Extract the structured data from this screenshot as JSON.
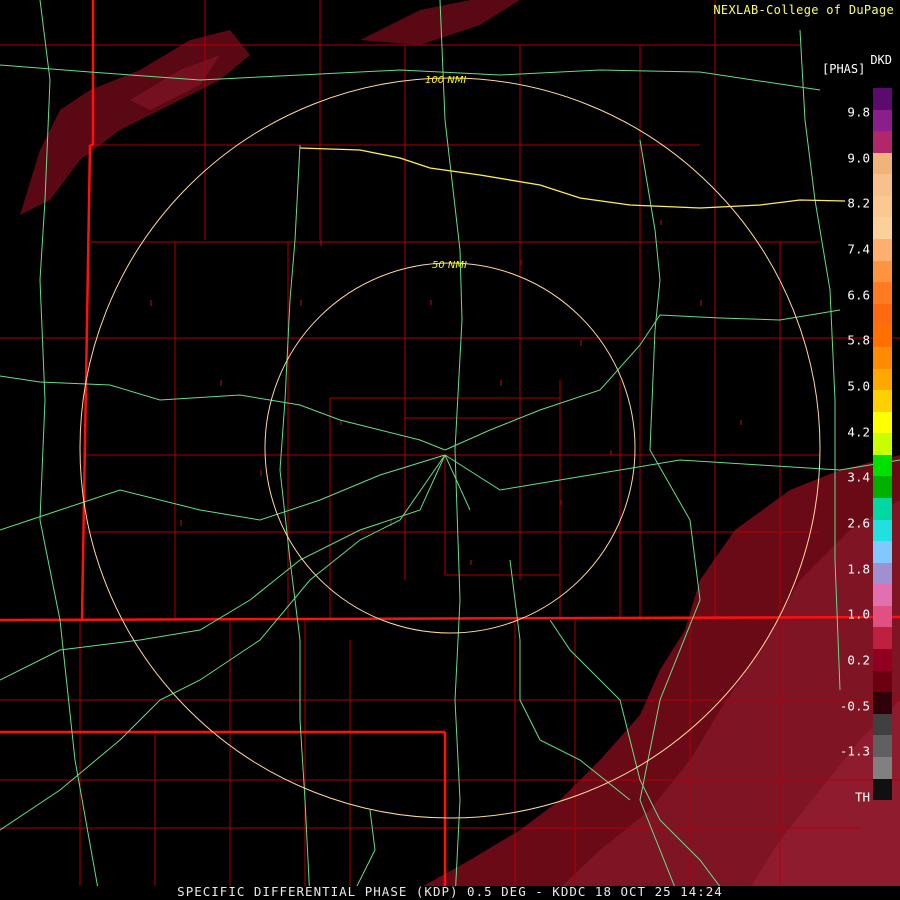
{
  "credit": "NEXLAB-College of DuPage",
  "footer": "SPECIFIC DIFFERENTIAL PHASE (KDP) 0.5 DEG - KDDC 18 OCT 25 14:24",
  "legend": {
    "unit": "[PHAS]",
    "code": "DKD",
    "ticks": [
      "9.8",
      "9.0",
      "8.2",
      "7.4",
      "6.6",
      "5.8",
      "5.0",
      "4.2",
      "3.4",
      "2.6",
      "1.8",
      "1.0",
      "0.2",
      "-0.5",
      "-1.3",
      "TH"
    ],
    "colors": [
      "#5b0a6e",
      "#8a1e8a",
      "#b0286a",
      "#f2b37a",
      "#f8c08c",
      "#fbc890",
      "#fbd09a",
      "#ffb070",
      "#ff9440",
      "#ff7a20",
      "#ff6a10",
      "#ff7000",
      "#ff8c00",
      "#ffa800",
      "#ffd000",
      "#ffff00",
      "#c8ff00",
      "#00e000",
      "#00b000",
      "#00d8a0",
      "#20e0e0",
      "#80c8ff",
      "#a090d0",
      "#e070b0",
      "#e05080",
      "#c02040",
      "#900020",
      "#6a0010",
      "#300008",
      "#404040",
      "#606060",
      "#808080",
      "#101010"
    ]
  },
  "range_rings": [
    {
      "label": "100 NMI"
    },
    {
      "label": "50 NMI"
    }
  ]
}
